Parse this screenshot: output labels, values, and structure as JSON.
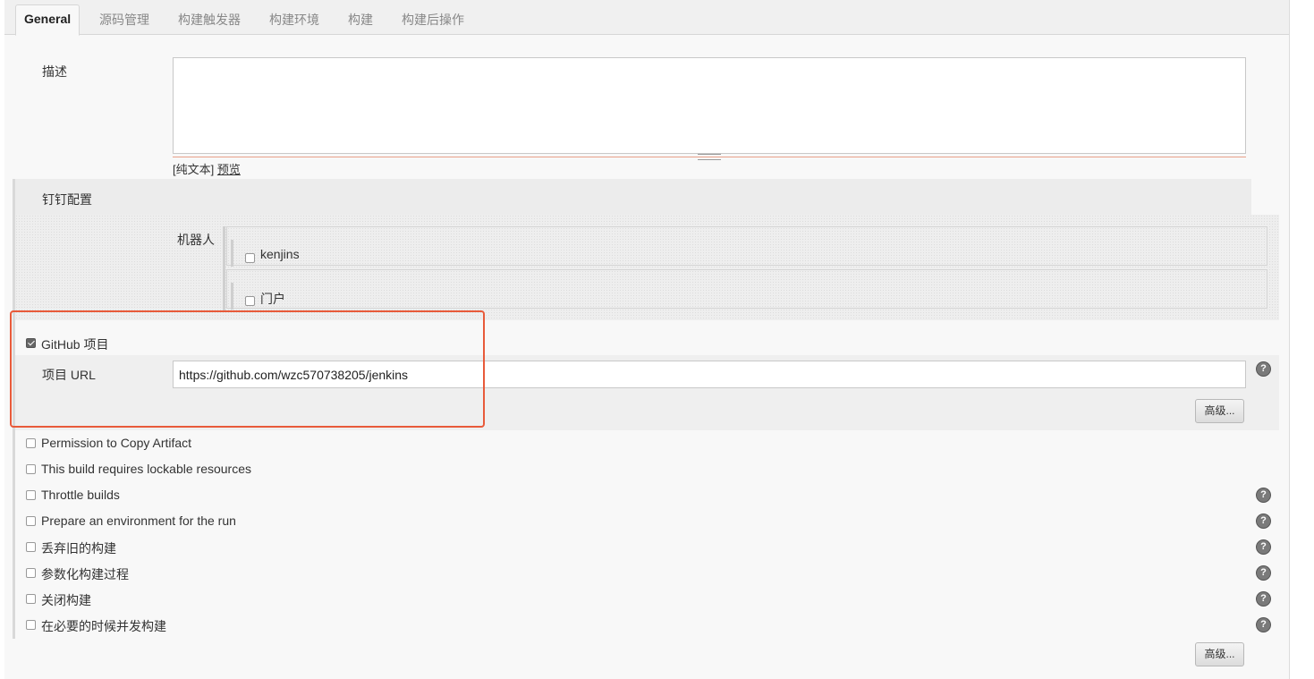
{
  "tabs": [
    "General",
    "源码管理",
    "构建触发器",
    "构建环境",
    "构建",
    "构建后操作"
  ],
  "description": {
    "label": "描述",
    "value": "",
    "format_prefix": "[纯文本]",
    "preview_link": "预览"
  },
  "dingtalk": {
    "title": "钉钉配置",
    "robot_label": "机器人",
    "robots": [
      {
        "label": "kenjins",
        "checked": false
      },
      {
        "label": "门户",
        "checked": false
      }
    ]
  },
  "github": {
    "label": "GitHub 项目",
    "checked": true,
    "url_label": "项目 URL",
    "url_value": "https://github.com/wzc570738205/jenkins",
    "advanced_label": "高级..."
  },
  "options": [
    {
      "label": "Permission to Copy Artifact",
      "checked": false,
      "help": false
    },
    {
      "label": "This build requires lockable resources",
      "checked": false,
      "help": false
    },
    {
      "label": "Throttle builds",
      "checked": false,
      "help": true
    },
    {
      "label": "Prepare an environment for the run",
      "checked": false,
      "help": true
    },
    {
      "label": "丢弃旧的构建",
      "checked": false,
      "help": true
    },
    {
      "label": "参数化构建过程",
      "checked": false,
      "help": true
    },
    {
      "label": "关闭构建",
      "checked": false,
      "help": true
    },
    {
      "label": "在必要的时候并发构建",
      "checked": false,
      "help": true
    }
  ],
  "footer": {
    "advanced_label": "高级..."
  },
  "help_glyph": "?",
  "accent": {
    "highlight": "#e85a3a"
  }
}
